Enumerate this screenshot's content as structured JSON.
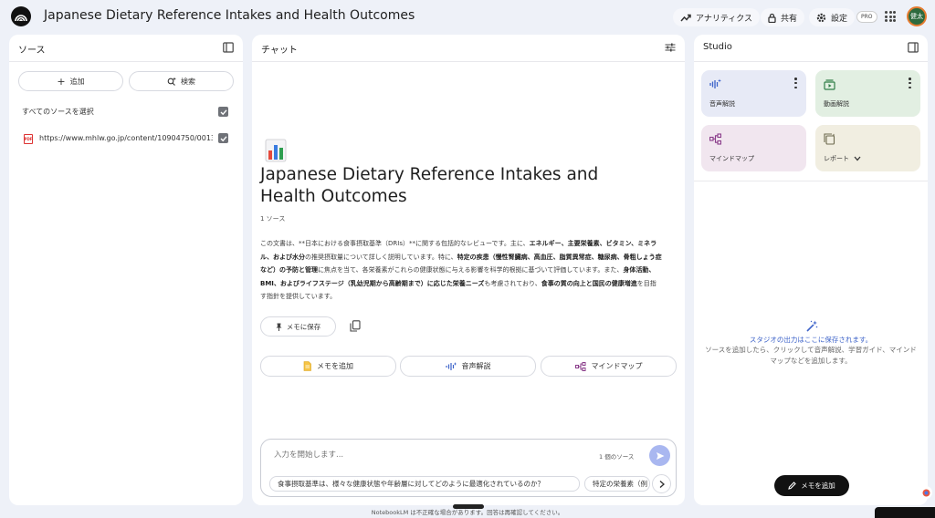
{
  "header": {
    "title": "Japanese Dietary Reference Intakes and Health Outcomes",
    "analytics_label": "アナリティクス",
    "share_label": "共有",
    "settings_label": "設定",
    "pro_badge": "PRO",
    "avatar_text": "健太"
  },
  "sources": {
    "title": "ソース",
    "add_label": "追加",
    "search_label": "検索",
    "select_all_label": "すべてのソースを選択",
    "items": [
      {
        "type_icon": "pdf-icon",
        "label": "https://www.mhlw.go.jp/content/10904750/0013...",
        "checked": true
      }
    ]
  },
  "chat": {
    "title": "チャット",
    "doc_title": "Japanese Dietary Reference Intakes and Health Outcomes",
    "source_count": "1 ソース",
    "summary": [
      {
        "t": "この文書は、**日本における食事摂取基準（DRIs）**に関する包括的なレビューです。主に、"
      },
      {
        "t": "エネルギー、主要栄養素、ビタミン、ミネラル、および水分",
        "b": true
      },
      {
        "t": "の推奨摂取量について詳しく説明しています。特に、"
      },
      {
        "t": "特定の疾患（慢性腎臓病、高血圧、脂質異常症、糖尿病、骨粗しょう症など）の予防と管理",
        "b": true
      },
      {
        "t": "に焦点を当て、各栄養素がこれらの健康状態に与える影響を科学的根拠に基づいて評価しています。また、"
      },
      {
        "t": "身体活動、BMI、およびライフステージ（乳幼児期から高齢期まで）に応じた栄養ニーズ",
        "b": true
      },
      {
        "t": "も考慮されており、"
      },
      {
        "t": "食事の質の向上と国民の健康増進",
        "b": true
      },
      {
        "t": "を目指す指針を提供しています。"
      }
    ],
    "save_note_label": "メモに保存",
    "actions": {
      "add_memo": "メモを追加",
      "audio_overview": "音声解説",
      "mind_map": "マインドマップ"
    },
    "composer": {
      "placeholder": "入力を開始します...",
      "source_count": "1 個のソース"
    },
    "suggestions": [
      "食事摂取基準は、様々な健康状態や年齢層に対してどのように最適化されているのか？",
      "特定の栄養素（例"
    ]
  },
  "studio": {
    "title": "Studio",
    "tiles": {
      "audio": "音声解説",
      "video": "動画解説",
      "mindmap": "マインドマップ",
      "report": "レポート"
    },
    "empty_title": "スタジオの出力はここに保存されます。",
    "empty_desc": "ソースを追加したら、クリックして音声解説、学習ガイド、マインドマップなどを追加します。",
    "add_note_label": "メモを追加"
  },
  "footer": {
    "disclaimer": "NotebookLM は不正確な場合があります。回答は再確認してください。"
  },
  "colors": {
    "background": "#eef1f8",
    "tile_audio": "#e7eaf6",
    "tile_video": "#e2efe2",
    "tile_mindmap": "#f1e6ef",
    "tile_report": "#f1eee1",
    "accent_blue": "#3d63c9"
  }
}
